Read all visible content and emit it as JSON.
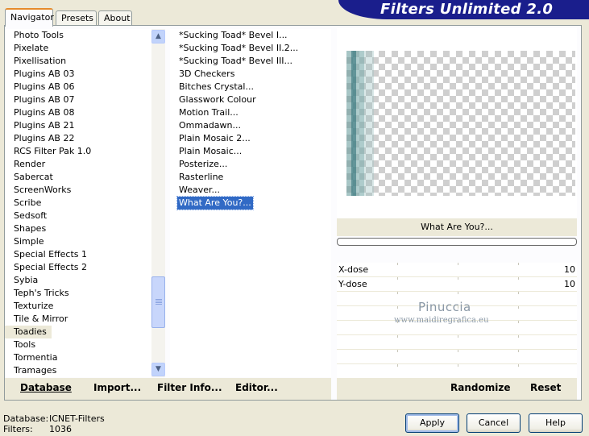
{
  "tabs": [
    "Navigator",
    "Presets",
    "About"
  ],
  "title": "Filters Unlimited 2.0",
  "categories": [
    "Photo Tools",
    "Pixelate",
    "Pixellisation",
    "Plugins AB 03",
    "Plugins AB 06",
    "Plugins AB 07",
    "Plugins AB 08",
    "Plugins AB 21",
    "Plugins AB 22",
    "RCS Filter Pak 1.0",
    "Render",
    "Sabercat",
    "ScreenWorks",
    "Scribe",
    "Sedsoft",
    "Shapes",
    "Simple",
    "Special Effects 1",
    "Special Effects 2",
    "Sybia",
    "Teph's Tricks",
    "Texturize",
    "Tile & Mirror",
    "Toadies",
    "Tools",
    "Tormentia",
    "Tramages"
  ],
  "selected_category": "Toadies",
  "filters": [
    "*Sucking Toad*  Bevel I...",
    "*Sucking Toad*  Bevel II.2...",
    "*Sucking Toad*  Bevel III...",
    "3D Checkers",
    "Bitches Crystal...",
    "Glasswork Colour",
    "Motion Trail...",
    "Ommadawn...",
    "Plain Mosaic 2...",
    "Plain Mosaic...",
    "Posterize...",
    "Rasterline",
    "Weaver...",
    "What Are You?..."
  ],
  "selected_filter": "What Are You?...",
  "preview": {
    "filter_name": "What Are You?...",
    "progress": 0
  },
  "params": [
    {
      "label": "X-dose",
      "value": "10"
    },
    {
      "label": "Y-dose",
      "value": "10"
    },
    {
      "label": "",
      "value": ""
    },
    {
      "label": "",
      "value": ""
    },
    {
      "label": "",
      "value": ""
    },
    {
      "label": "",
      "value": ""
    },
    {
      "label": "",
      "value": ""
    },
    {
      "label": "",
      "value": ""
    }
  ],
  "watermark": {
    "name": "Pinuccia",
    "url": "www.maidiregrafica.eu"
  },
  "toolbar": {
    "database_label": "Database",
    "import_label": "Import...",
    "filter_info_label": "Filter Info...",
    "editor_label": "Editor...",
    "randomize_label": "Randomize",
    "reset_label": "Reset"
  },
  "status": {
    "database_key": "Database:",
    "database_val": "ICNET-Filters",
    "filters_key": "Filters:",
    "filters_val": "1036"
  },
  "buttons": {
    "apply": "Apply",
    "cancel": "Cancel",
    "help": "Help"
  },
  "colors": {
    "banner": "#1a1e8c",
    "selection": "#316ac5",
    "face": "#ece9d8"
  },
  "icons": {
    "scroll_up": "chevron-up-icon",
    "scroll_down": "chevron-down-icon"
  }
}
